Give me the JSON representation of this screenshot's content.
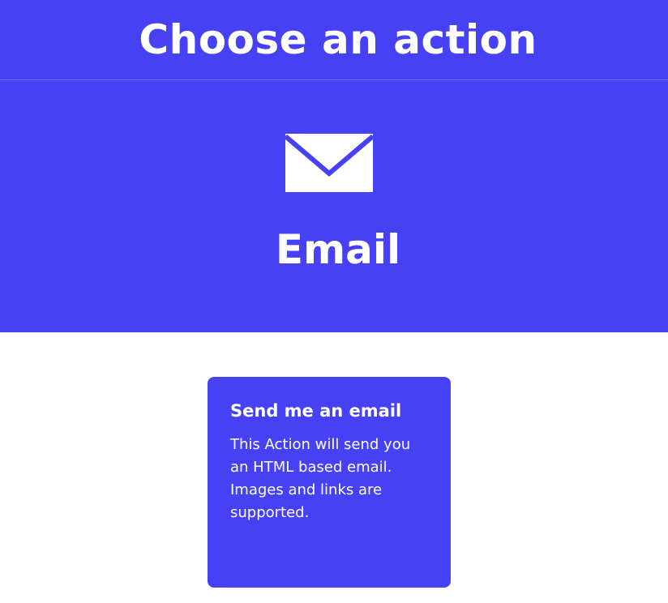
{
  "header": {
    "title": "Choose an action"
  },
  "service": {
    "name": "Email",
    "icon": "envelope-icon",
    "brand_color": "#4641f5"
  },
  "actions": [
    {
      "title": "Send me an email",
      "description": "This Action will send you an HTML based email. Images and links are supported."
    }
  ]
}
